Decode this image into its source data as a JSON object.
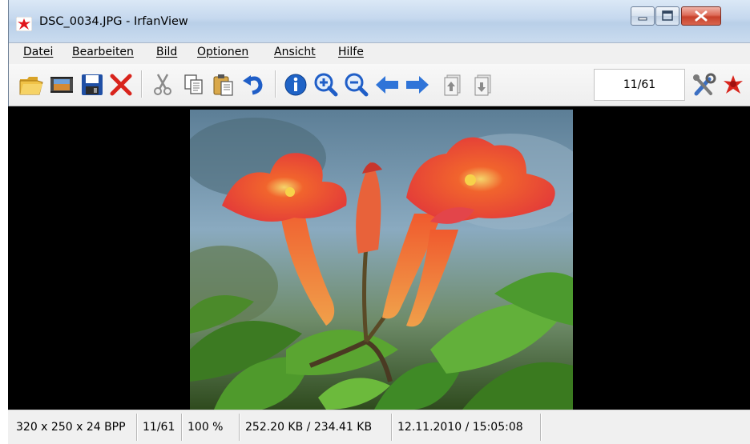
{
  "window": {
    "title": "DSC_0034.JPG - IrfanView"
  },
  "menu": {
    "items": [
      {
        "label": "Datei"
      },
      {
        "label": "Bearbeiten"
      },
      {
        "label": "Bild"
      },
      {
        "label": "Optionen"
      },
      {
        "label": "Ansicht"
      },
      {
        "label": "Hilfe"
      }
    ]
  },
  "toolbar": {
    "buttons": [
      "open-folder-icon",
      "slideshow-icon",
      "save-icon",
      "delete-icon",
      "cut-icon",
      "copy-icon",
      "paste-icon",
      "undo-icon",
      "info-icon",
      "zoom-in-icon",
      "zoom-out-icon",
      "previous-icon",
      "next-icon",
      "first-page-icon",
      "last-page-icon",
      "settings-icon",
      "irfanview-icon"
    ],
    "page_indicator": "11/61"
  },
  "image": {
    "subject": "flower-photo"
  },
  "status": {
    "dimensions": "320 x 250 x 24 BPP",
    "index": "11/61",
    "zoom": "100 %",
    "filesize": "252.20 KB / 234.41 KB",
    "datetime": "12.11.2010 / 15:05:08"
  },
  "colors": {
    "accent_red": "#d8241c",
    "title_bar": "#c5d8ee",
    "viewer_bg": "#000000"
  }
}
